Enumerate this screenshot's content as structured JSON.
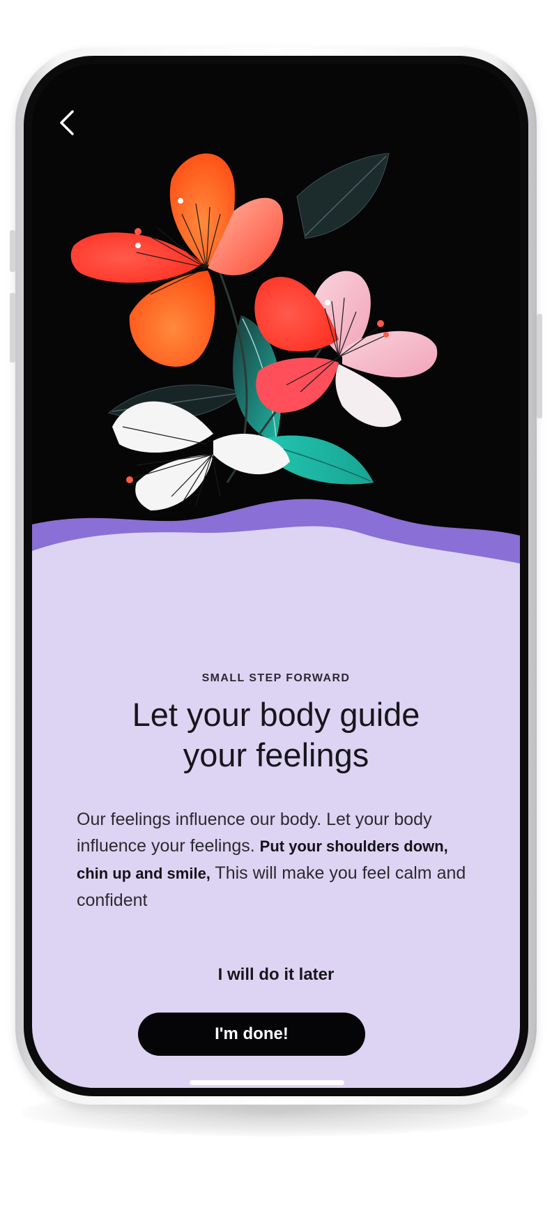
{
  "screen": {
    "eyebrow": "SMALL STEP FORWARD",
    "title_line1": "Let your body guide",
    "title_line2": "your feelings",
    "body_intro": "Our feelings influence our body. Let your body influence your feelings.",
    "body_bold": "Put your shoulders down, chin up and smile,",
    "body_outro": "This will make you feel calm and confident",
    "later_label": "I will do it later",
    "done_label": "I'm done!"
  },
  "icons": {
    "back": "chevron-left-icon"
  },
  "colors": {
    "illustration_background": "#060606",
    "panel_background": "#ddd4f3",
    "wave_accent": "#8a6fd6",
    "button_background": "#050507",
    "button_text": "#ffffff",
    "petal_orange": "#ff5a1a",
    "petal_red": "#ff3d2e",
    "petal_pink": "#f7c4d1",
    "leaf_teal": "#1fb7a5",
    "leaf_dark": "#1d2d2e"
  }
}
